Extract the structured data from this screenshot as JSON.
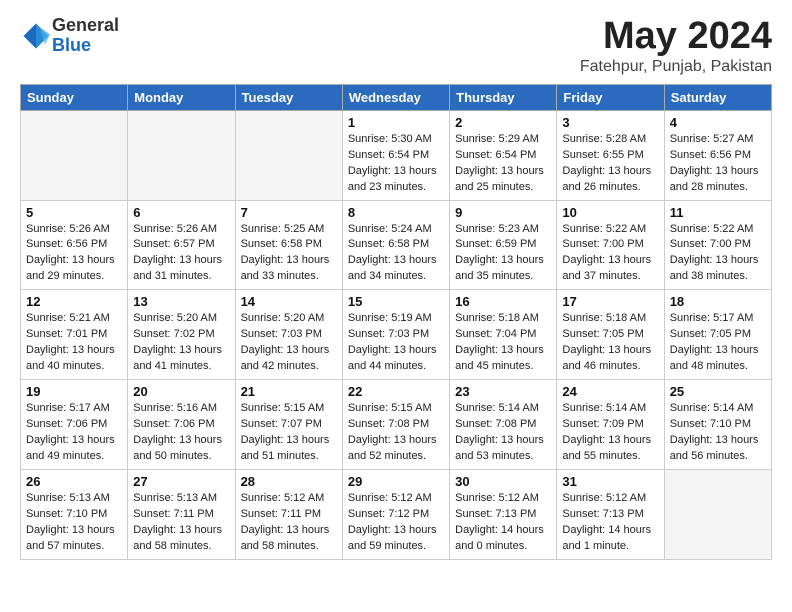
{
  "logo": {
    "general": "General",
    "blue": "Blue"
  },
  "title": {
    "month_year": "May 2024",
    "location": "Fatehpur, Punjab, Pakistan"
  },
  "days_header": [
    "Sunday",
    "Monday",
    "Tuesday",
    "Wednesday",
    "Thursday",
    "Friday",
    "Saturday"
  ],
  "weeks": [
    [
      {
        "num": "",
        "info": ""
      },
      {
        "num": "",
        "info": ""
      },
      {
        "num": "",
        "info": ""
      },
      {
        "num": "1",
        "info": "Sunrise: 5:30 AM\nSunset: 6:54 PM\nDaylight: 13 hours\nand 23 minutes."
      },
      {
        "num": "2",
        "info": "Sunrise: 5:29 AM\nSunset: 6:54 PM\nDaylight: 13 hours\nand 25 minutes."
      },
      {
        "num": "3",
        "info": "Sunrise: 5:28 AM\nSunset: 6:55 PM\nDaylight: 13 hours\nand 26 minutes."
      },
      {
        "num": "4",
        "info": "Sunrise: 5:27 AM\nSunset: 6:56 PM\nDaylight: 13 hours\nand 28 minutes."
      }
    ],
    [
      {
        "num": "5",
        "info": "Sunrise: 5:26 AM\nSunset: 6:56 PM\nDaylight: 13 hours\nand 29 minutes."
      },
      {
        "num": "6",
        "info": "Sunrise: 5:26 AM\nSunset: 6:57 PM\nDaylight: 13 hours\nand 31 minutes."
      },
      {
        "num": "7",
        "info": "Sunrise: 5:25 AM\nSunset: 6:58 PM\nDaylight: 13 hours\nand 33 minutes."
      },
      {
        "num": "8",
        "info": "Sunrise: 5:24 AM\nSunset: 6:58 PM\nDaylight: 13 hours\nand 34 minutes."
      },
      {
        "num": "9",
        "info": "Sunrise: 5:23 AM\nSunset: 6:59 PM\nDaylight: 13 hours\nand 35 minutes."
      },
      {
        "num": "10",
        "info": "Sunrise: 5:22 AM\nSunset: 7:00 PM\nDaylight: 13 hours\nand 37 minutes."
      },
      {
        "num": "11",
        "info": "Sunrise: 5:22 AM\nSunset: 7:00 PM\nDaylight: 13 hours\nand 38 minutes."
      }
    ],
    [
      {
        "num": "12",
        "info": "Sunrise: 5:21 AM\nSunset: 7:01 PM\nDaylight: 13 hours\nand 40 minutes."
      },
      {
        "num": "13",
        "info": "Sunrise: 5:20 AM\nSunset: 7:02 PM\nDaylight: 13 hours\nand 41 minutes."
      },
      {
        "num": "14",
        "info": "Sunrise: 5:20 AM\nSunset: 7:03 PM\nDaylight: 13 hours\nand 42 minutes."
      },
      {
        "num": "15",
        "info": "Sunrise: 5:19 AM\nSunset: 7:03 PM\nDaylight: 13 hours\nand 44 minutes."
      },
      {
        "num": "16",
        "info": "Sunrise: 5:18 AM\nSunset: 7:04 PM\nDaylight: 13 hours\nand 45 minutes."
      },
      {
        "num": "17",
        "info": "Sunrise: 5:18 AM\nSunset: 7:05 PM\nDaylight: 13 hours\nand 46 minutes."
      },
      {
        "num": "18",
        "info": "Sunrise: 5:17 AM\nSunset: 7:05 PM\nDaylight: 13 hours\nand 48 minutes."
      }
    ],
    [
      {
        "num": "19",
        "info": "Sunrise: 5:17 AM\nSunset: 7:06 PM\nDaylight: 13 hours\nand 49 minutes."
      },
      {
        "num": "20",
        "info": "Sunrise: 5:16 AM\nSunset: 7:06 PM\nDaylight: 13 hours\nand 50 minutes."
      },
      {
        "num": "21",
        "info": "Sunrise: 5:15 AM\nSunset: 7:07 PM\nDaylight: 13 hours\nand 51 minutes."
      },
      {
        "num": "22",
        "info": "Sunrise: 5:15 AM\nSunset: 7:08 PM\nDaylight: 13 hours\nand 52 minutes."
      },
      {
        "num": "23",
        "info": "Sunrise: 5:14 AM\nSunset: 7:08 PM\nDaylight: 13 hours\nand 53 minutes."
      },
      {
        "num": "24",
        "info": "Sunrise: 5:14 AM\nSunset: 7:09 PM\nDaylight: 13 hours\nand 55 minutes."
      },
      {
        "num": "25",
        "info": "Sunrise: 5:14 AM\nSunset: 7:10 PM\nDaylight: 13 hours\nand 56 minutes."
      }
    ],
    [
      {
        "num": "26",
        "info": "Sunrise: 5:13 AM\nSunset: 7:10 PM\nDaylight: 13 hours\nand 57 minutes."
      },
      {
        "num": "27",
        "info": "Sunrise: 5:13 AM\nSunset: 7:11 PM\nDaylight: 13 hours\nand 58 minutes."
      },
      {
        "num": "28",
        "info": "Sunrise: 5:12 AM\nSunset: 7:11 PM\nDaylight: 13 hours\nand 58 minutes."
      },
      {
        "num": "29",
        "info": "Sunrise: 5:12 AM\nSunset: 7:12 PM\nDaylight: 13 hours\nand 59 minutes."
      },
      {
        "num": "30",
        "info": "Sunrise: 5:12 AM\nSunset: 7:13 PM\nDaylight: 14 hours\nand 0 minutes."
      },
      {
        "num": "31",
        "info": "Sunrise: 5:12 AM\nSunset: 7:13 PM\nDaylight: 14 hours\nand 1 minute."
      },
      {
        "num": "",
        "info": ""
      }
    ]
  ]
}
